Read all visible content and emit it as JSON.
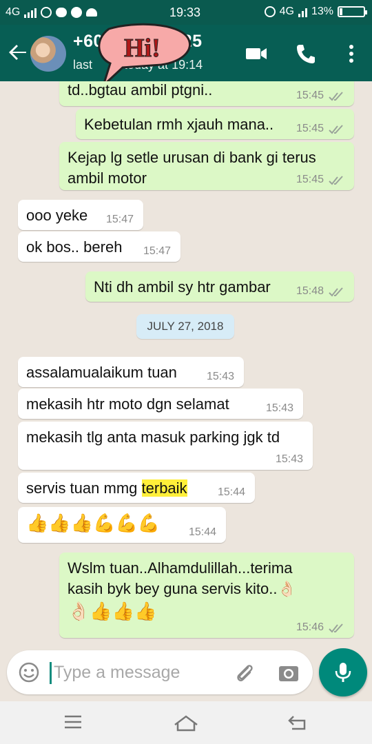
{
  "status_bar": {
    "network_left": "4G",
    "time": "19:33",
    "network_right": "4G",
    "battery": "13%",
    "battery_level": 0.13
  },
  "header": {
    "contact_name": "+60",
    "contact_name_tail": "5725",
    "last_seen_prefix": "last",
    "last_seen_suffix": "today at 19:14",
    "sticker_text": "Hi!"
  },
  "messages": [
    {
      "dir": "out",
      "text": "td..bgtau ambil ptgni..",
      "time": "15:45"
    },
    {
      "dir": "out",
      "text": "Kebetulan rmh xjauh mana..",
      "time": "15:45"
    },
    {
      "dir": "out",
      "text": "Kejap lg setle urusan di bank gi terus ambil motor",
      "time": "15:45"
    },
    {
      "dir": "in",
      "text": "ooo yeke",
      "time": "15:47"
    },
    {
      "dir": "in",
      "text": "ok bos.. bereh",
      "time": "15:47"
    },
    {
      "dir": "out",
      "text": "Nti dh ambil sy htr gambar",
      "time": "15:48"
    },
    {
      "dir": "in",
      "text": "assalamualaikum tuan",
      "time": "15:43"
    },
    {
      "dir": "in",
      "text": "mekasih htr moto dgn selamat",
      "time": "15:43"
    },
    {
      "dir": "in",
      "text": "mekasih tlg anta masuk parking jgk td",
      "time": "15:43"
    },
    {
      "dir": "in",
      "text": "servis tuan mmg",
      "highlight": "terbaik",
      "time": "15:44"
    },
    {
      "dir": "in",
      "text": "👍👍👍💪💪💪",
      "time": "15:44"
    },
    {
      "dir": "out",
      "text": "Wslm tuan..Alhamdulillah...terima kasih byk bey guna servis kito..👌🏻",
      "emoji_line": "👌🏻👍👍👍",
      "time": "15:46"
    }
  ],
  "date_divider": "JULY 27, 2018",
  "composer": {
    "placeholder": "Type a message"
  },
  "icons": [
    "back-arrow-icon",
    "video-call-icon",
    "phone-icon",
    "more-vert-icon",
    "emoji-icon",
    "attach-icon",
    "camera-icon",
    "mic-icon"
  ],
  "colors": {
    "toolbar": "#075e54",
    "status_bar": "#0a5a4f",
    "outgoing_bubble": "#dcf8c6",
    "incoming_bubble": "#ffffff",
    "chat_bg": "#ece5dd",
    "mic_button": "#00897b",
    "highlight": "#ffef3a"
  }
}
